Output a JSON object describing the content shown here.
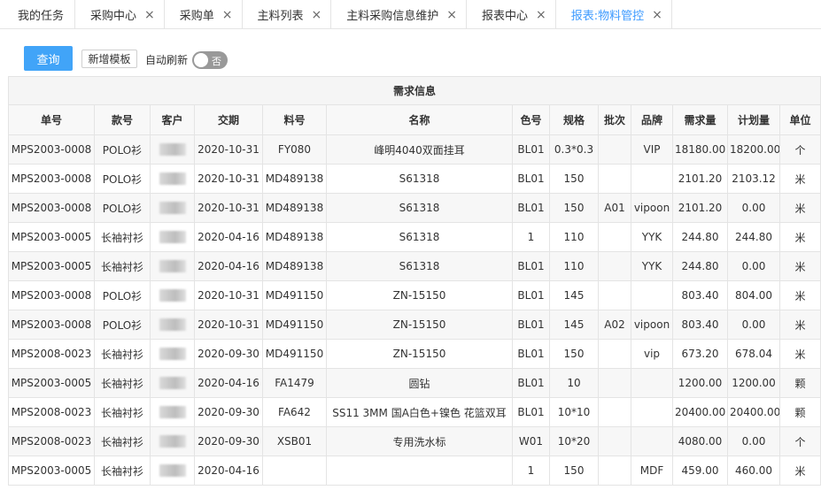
{
  "tabs": [
    {
      "label": "我的任务",
      "closable": false,
      "active": false
    },
    {
      "label": "采购中心",
      "closable": true,
      "active": false
    },
    {
      "label": "采购单",
      "closable": true,
      "active": false
    },
    {
      "label": "主料列表",
      "closable": true,
      "active": false
    },
    {
      "label": "主料采购信息维护",
      "closable": true,
      "active": false
    },
    {
      "label": "报表中心",
      "closable": true,
      "active": false
    },
    {
      "label": "报表:物料管控",
      "closable": true,
      "active": true
    }
  ],
  "close_glyph": "×",
  "toolbar": {
    "query_label": "查询",
    "template_label": "新增模板",
    "auto_refresh_label": "自动刷新",
    "switch_text": "否"
  },
  "table": {
    "group_header": "需求信息",
    "columns": [
      "单号",
      "款号",
      "客户",
      "交期",
      "料号",
      "名称",
      "色号",
      "规格",
      "批次",
      "品牌",
      "需求量",
      "计划量",
      "单位"
    ],
    "rows": [
      [
        "MPS2003-0008",
        "POLO衫",
        "",
        "2020-10-31",
        "FY080",
        "峰明4040双面挂耳",
        "BL01",
        "0.3*0.3",
        "",
        "VIP",
        "18180.00",
        "18200.00",
        "个"
      ],
      [
        "MPS2003-0008",
        "POLO衫",
        "",
        "2020-10-31",
        "MD489138",
        "S61318",
        "BL01",
        "150",
        "",
        "",
        "2101.20",
        "2103.12",
        "米"
      ],
      [
        "MPS2003-0008",
        "POLO衫",
        "",
        "2020-10-31",
        "MD489138",
        "S61318",
        "BL01",
        "150",
        "A01",
        "vipoon",
        "2101.20",
        "0.00",
        "米"
      ],
      [
        "MPS2003-0005",
        "长袖衬衫",
        "",
        "2020-04-16",
        "MD489138",
        "S61318",
        "1",
        "110",
        "",
        "YYK",
        "244.80",
        "244.80",
        "米"
      ],
      [
        "MPS2003-0005",
        "长袖衬衫",
        "",
        "2020-04-16",
        "MD489138",
        "S61318",
        "BL01",
        "110",
        "",
        "YYK",
        "244.80",
        "0.00",
        "米"
      ],
      [
        "MPS2003-0008",
        "POLO衫",
        "",
        "2020-10-31",
        "MD491150",
        "ZN-15150",
        "BL01",
        "145",
        "",
        "",
        "803.40",
        "804.00",
        "米"
      ],
      [
        "MPS2003-0008",
        "POLO衫",
        "",
        "2020-10-31",
        "MD491150",
        "ZN-15150",
        "BL01",
        "145",
        "A02",
        "vipoon",
        "803.40",
        "0.00",
        "米"
      ],
      [
        "MPS2008-0023",
        "长袖衬衫",
        "",
        "2020-09-30",
        "MD491150",
        "ZN-15150",
        "BL01",
        "150",
        "",
        "vip",
        "673.20",
        "678.04",
        "米"
      ],
      [
        "MPS2003-0005",
        "长袖衬衫",
        "",
        "2020-04-16",
        "FA1479",
        "圆钻",
        "BL01",
        "10",
        "",
        "",
        "1200.00",
        "1200.00",
        "颗"
      ],
      [
        "MPS2008-0023",
        "长袖衬衫",
        "",
        "2020-09-30",
        "FA642",
        "SS11 3MM 国A白色+镍色 花篮双耳",
        "BL01",
        "10*10",
        "",
        "",
        "20400.00",
        "20400.00",
        "颗"
      ],
      [
        "MPS2008-0023",
        "长袖衬衫",
        "",
        "2020-09-30",
        "XSB01",
        "专用洗水标",
        "W01",
        "10*20",
        "",
        "",
        "4080.00",
        "0.00",
        "个"
      ],
      [
        "MPS2003-0005",
        "长袖衬衫",
        "",
        "2020-04-16",
        "",
        "",
        "1",
        "150",
        "",
        "MDF",
        "459.00",
        "460.00",
        "米"
      ]
    ]
  },
  "colors": {
    "accent": "#3e9bff",
    "query_button": "#41a4f8",
    "switch_off": "#999999",
    "border": "#e4e4e4"
  }
}
